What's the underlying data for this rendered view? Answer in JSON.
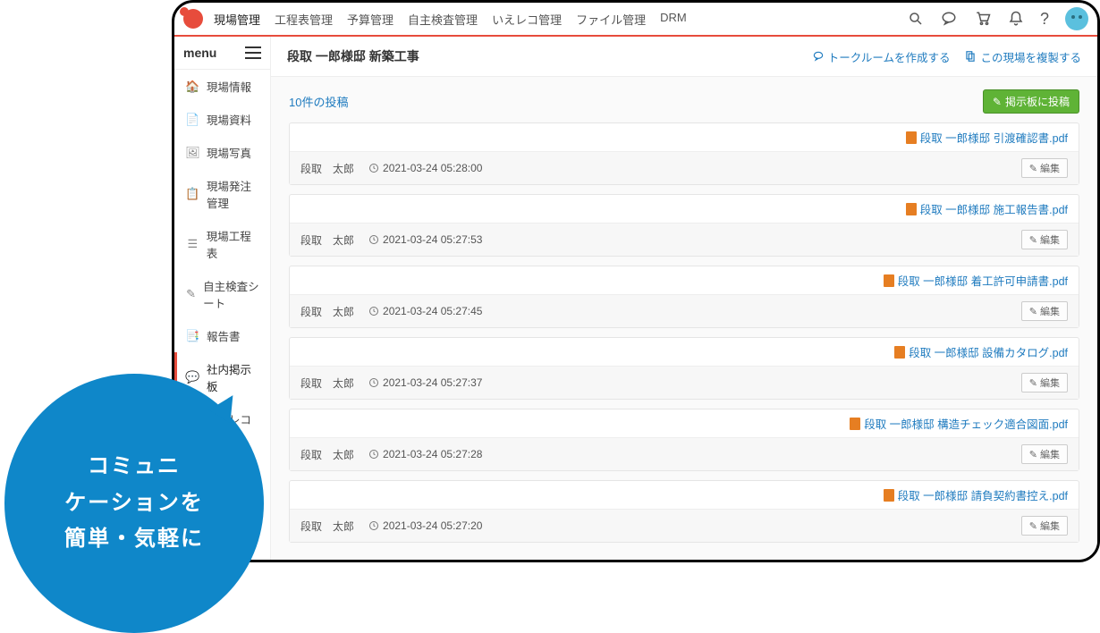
{
  "topnav": [
    {
      "label": "現場管理",
      "active": true
    },
    {
      "label": "工程表管理"
    },
    {
      "label": "予算管理"
    },
    {
      "label": "自主検査管理"
    },
    {
      "label": "いえレコ管理"
    },
    {
      "label": "ファイル管理"
    },
    {
      "label": "DRM"
    }
  ],
  "sidebar": {
    "heading": "menu",
    "items": [
      {
        "icon": "🏠",
        "label": "現場情報",
        "name": "info"
      },
      {
        "icon": "📄",
        "label": "現場資料",
        "name": "docs"
      },
      {
        "icon": "🖼",
        "label": "現場写真",
        "name": "photos"
      },
      {
        "icon": "📋",
        "label": "現場発注管理",
        "name": "order"
      },
      {
        "icon": "☰",
        "label": "現場工程表",
        "name": "schedule"
      },
      {
        "icon": "✎",
        "label": "自主検査シート",
        "name": "inspect"
      },
      {
        "icon": "📑",
        "label": "報告書",
        "name": "report"
      },
      {
        "icon": "💬",
        "label": "社内掲示板",
        "name": "board",
        "active": true
      },
      {
        "icon": "⌂",
        "label": "いえレコ",
        "name": "iereco"
      }
    ]
  },
  "main": {
    "title": "段取 一郎様邸 新築工事",
    "talkroom_label": "トークルームを作成する",
    "duplicate_label": "この現場を複製する",
    "post_count_label": "10件の投稿",
    "post_button_label": "掲示板に投稿",
    "edit_label": "編集",
    "posts": [
      {
        "file": "段取 一郎様邸 引渡確認書.pdf",
        "author": "段取　太郎",
        "ts": "2021-03-24 05:28:00"
      },
      {
        "file": "段取 一郎様邸 施工報告書.pdf",
        "author": "段取　太郎",
        "ts": "2021-03-24 05:27:53"
      },
      {
        "file": "段取 一郎様邸 着工許可申請書.pdf",
        "author": "段取　太郎",
        "ts": "2021-03-24 05:27:45"
      },
      {
        "file": "段取 一郎様邸 設備カタログ.pdf",
        "author": "段取　太郎",
        "ts": "2021-03-24 05:27:37"
      },
      {
        "file": "段取 一郎様邸 構造チェック適合図面.pdf",
        "author": "段取　太郎",
        "ts": "2021-03-24 05:27:28"
      },
      {
        "file": "段取 一郎様邸 請負契約書控え.pdf",
        "author": "段取　太郎",
        "ts": "2021-03-24 05:27:20"
      }
    ]
  },
  "bubble": {
    "line1": "コミュニ",
    "line2": "ケーションを",
    "line3": "簡単・気軽に"
  }
}
